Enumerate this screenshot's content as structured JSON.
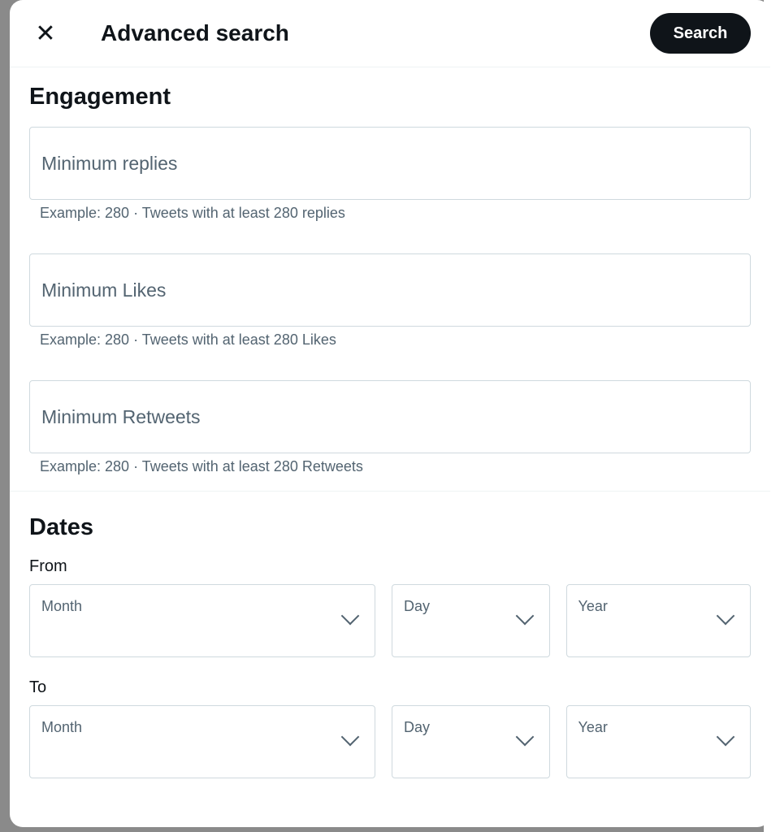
{
  "header": {
    "title": "Advanced search",
    "search_label": "Search"
  },
  "engagement": {
    "heading": "Engagement",
    "fields": [
      {
        "placeholder": "Minimum replies",
        "hint": "Example: 280 · Tweets with at least 280 replies"
      },
      {
        "placeholder": "Minimum Likes",
        "hint": "Example: 280 · Tweets with at least 280 Likes"
      },
      {
        "placeholder": "Minimum Retweets",
        "hint": "Example: 280 · Tweets with at least 280 Retweets"
      }
    ]
  },
  "dates": {
    "heading": "Dates",
    "from_label": "From",
    "to_label": "To",
    "month": "Month",
    "day": "Day",
    "year": "Year"
  }
}
